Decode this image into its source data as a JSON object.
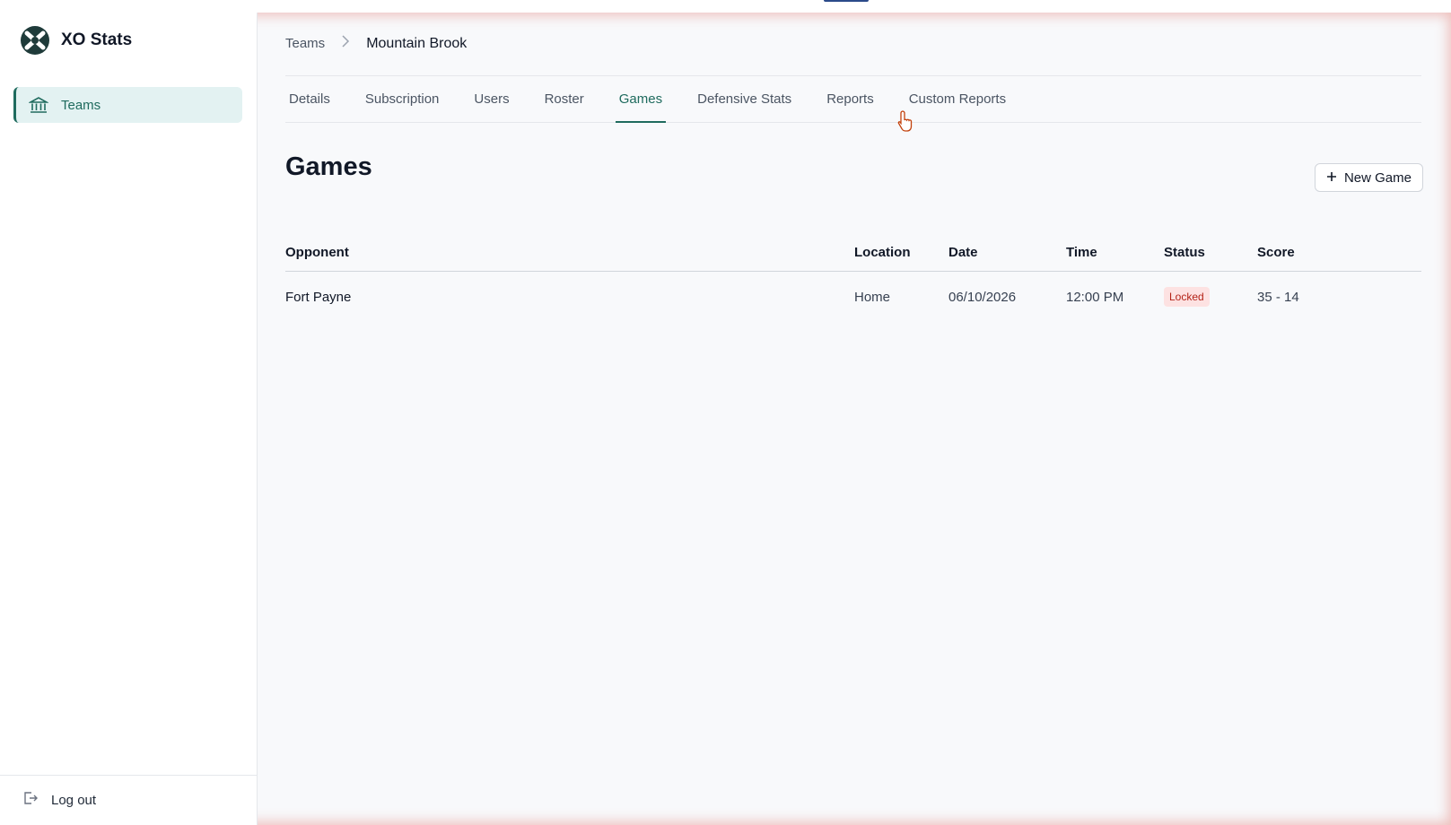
{
  "app": {
    "name": "XO Stats",
    "logo_icon": "xo-logo-icon",
    "accent_color": "#1f6b5e"
  },
  "sidebar": {
    "items": [
      {
        "label": "Teams",
        "icon": "bank-icon",
        "active": true
      }
    ],
    "footer": {
      "label": "Log out",
      "icon": "logout-icon"
    }
  },
  "breadcrumb": {
    "parent": "Teams",
    "current": "Mountain Brook"
  },
  "tabs": [
    {
      "label": "Details"
    },
    {
      "label": "Subscription"
    },
    {
      "label": "Users"
    },
    {
      "label": "Roster"
    },
    {
      "label": "Games",
      "active": true
    },
    {
      "label": "Defensive Stats"
    },
    {
      "label": "Reports"
    },
    {
      "label": "Custom Reports"
    }
  ],
  "page": {
    "title": "Games",
    "new_button_label": "New Game"
  },
  "table": {
    "headers": {
      "opponent": "Opponent",
      "location": "Location",
      "date": "Date",
      "time": "Time",
      "status": "Status",
      "score": "Score"
    },
    "rows": [
      {
        "opponent": "Fort Payne",
        "location": "Home",
        "date": "06/10/2026",
        "time": "12:00 PM",
        "status": "Locked",
        "score": "35 - 14"
      }
    ]
  }
}
